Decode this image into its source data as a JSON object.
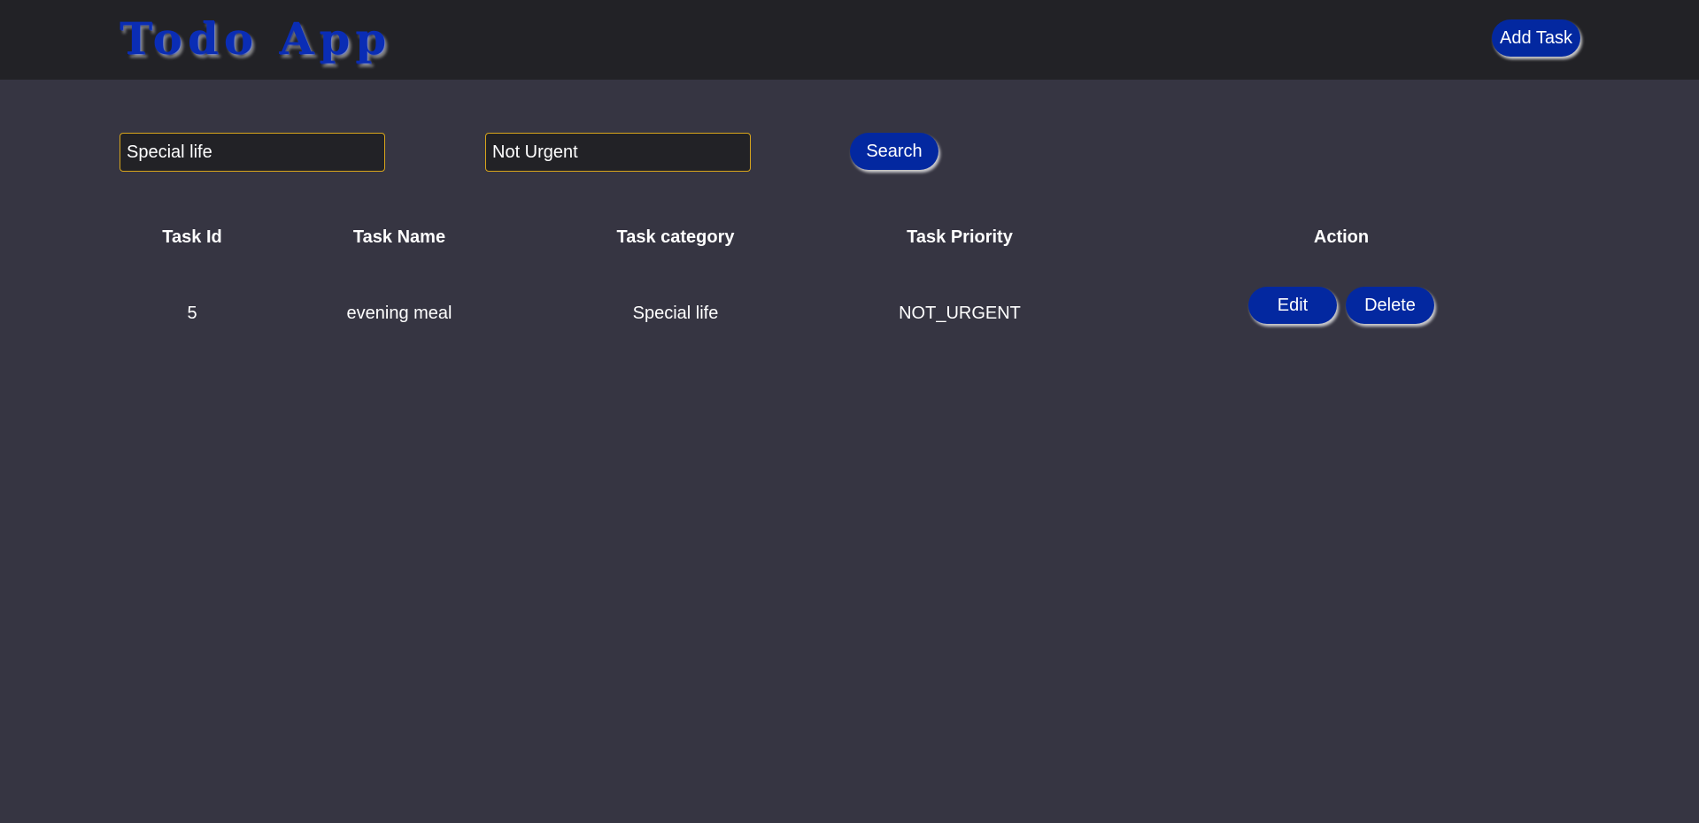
{
  "header": {
    "logo_text": "Todo App",
    "add_task_label": "Add Task"
  },
  "filters": {
    "category_value": "Special life",
    "priority_value": "Not Urgent",
    "search_label": "Search"
  },
  "table": {
    "columns": [
      "Task Id",
      "Task Name",
      "Task category",
      "Task Priority",
      "Action"
    ],
    "rows": [
      {
        "id": "5",
        "name": "evening meal",
        "category": "Special life",
        "priority": "NOT_URGENT",
        "edit_label": "Edit",
        "delete_label": "Delete"
      }
    ]
  },
  "colors": {
    "background": "#363542",
    "topbar": "#222226",
    "accent": "#0328a0",
    "input_border": "#d8a51b"
  }
}
